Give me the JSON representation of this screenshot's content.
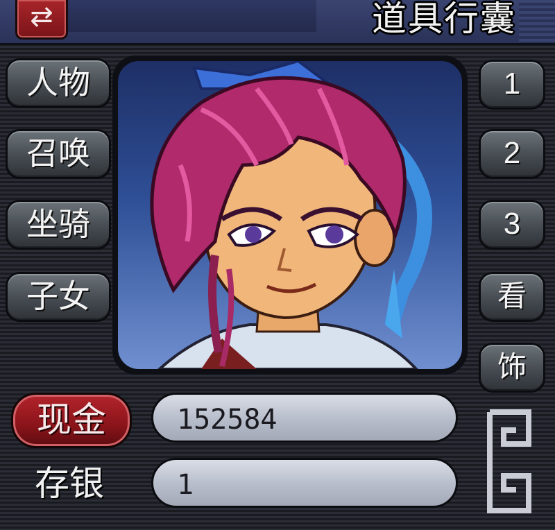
{
  "header": {
    "title": "道具行囊",
    "swap_icon": "⇄"
  },
  "tabs": [
    {
      "label": "人物"
    },
    {
      "label": "召唤"
    },
    {
      "label": "坐骑"
    },
    {
      "label": "子女"
    }
  ],
  "side_buttons": [
    {
      "label": "1"
    },
    {
      "label": "2"
    },
    {
      "label": "3"
    },
    {
      "label": "看"
    },
    {
      "label": "饰"
    }
  ],
  "currency": {
    "cash_label": "现金",
    "cash_value": "152584",
    "bank_label": "存银",
    "bank_value": "1"
  },
  "colors": {
    "accent_red": "#a8252a",
    "panel_dark": "#2a2d35",
    "header_blue": "#3a4470",
    "value_box": "#c4c9d4"
  }
}
